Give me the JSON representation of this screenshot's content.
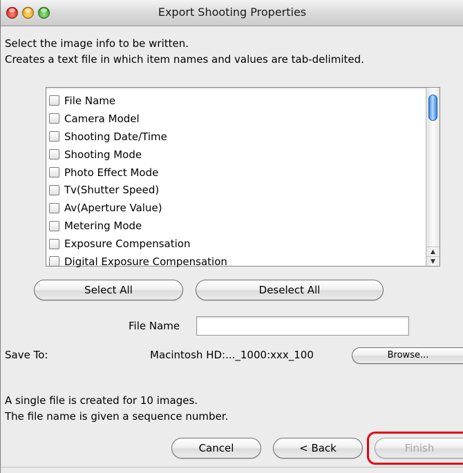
{
  "window": {
    "title": "Export Shooting Properties"
  },
  "description": {
    "line1": "Select the image info to be written.",
    "line2": "Creates a text file in which item names and values are tab-delimited."
  },
  "items": [
    {
      "label": "File Name",
      "checked": false
    },
    {
      "label": "Camera Model",
      "checked": false
    },
    {
      "label": "Shooting Date/Time",
      "checked": false
    },
    {
      "label": "Shooting Mode",
      "checked": false
    },
    {
      "label": "Photo Effect Mode",
      "checked": false
    },
    {
      "label": "Tv(Shutter Speed)",
      "checked": false
    },
    {
      "label": "Av(Aperture Value)",
      "checked": false
    },
    {
      "label": "Metering Mode",
      "checked": false
    },
    {
      "label": "Exposure Compensation",
      "checked": false
    },
    {
      "label": "Digital Exposure Compensation",
      "checked": false
    }
  ],
  "buttons": {
    "select_all": "Select All",
    "deselect_all": "Deselect All",
    "browse": "Browse...",
    "cancel": "Cancel",
    "back": "< Back",
    "finish": "Finish"
  },
  "file_name": {
    "label": "File Name",
    "value": ""
  },
  "save_to": {
    "label": "Save To:",
    "path": "Macintosh HD:..._1000:xxx_100"
  },
  "info": {
    "line1": "A single file is created for 10 images.",
    "line2": "The file name is given a sequence number."
  },
  "colors": {
    "highlight": "#e3000f",
    "scroll_thumb": "#3b86e0"
  }
}
